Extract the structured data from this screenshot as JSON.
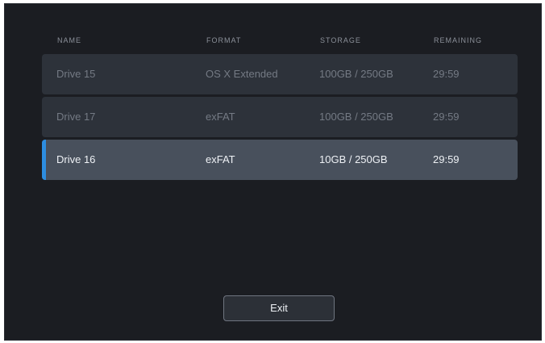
{
  "columns": {
    "name": "NAME",
    "format": "FORMAT",
    "storage": "STORAGE",
    "remaining": "REMAINING"
  },
  "drives": [
    {
      "name": "Drive 15",
      "format": "OS X Extended",
      "storage": "100GB / 250GB",
      "remaining": "29:59",
      "selected": false
    },
    {
      "name": "Drive 17",
      "format": "exFAT",
      "storage": "100GB / 250GB",
      "remaining": "29:59",
      "selected": false
    },
    {
      "name": "Drive 16",
      "format": "exFAT",
      "storage": "10GB / 250GB",
      "remaining": "29:59",
      "selected": true
    }
  ],
  "exit_label": "Exit",
  "colors": {
    "background": "#1b1d22",
    "row": "#2d323a",
    "row_selected": "#48505c",
    "accent": "#2d8de0"
  }
}
